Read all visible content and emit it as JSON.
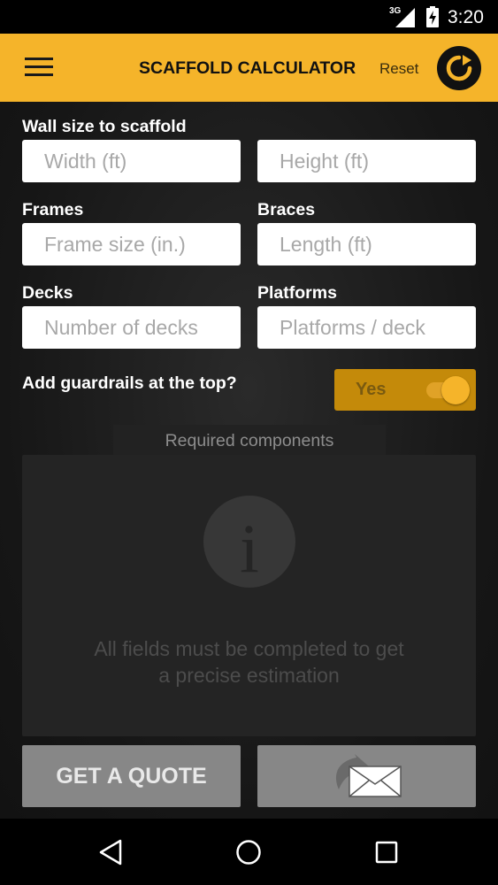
{
  "status_bar": {
    "network": "3G",
    "time": "3:20",
    "icons": [
      "signal-icon",
      "battery-charging-icon"
    ]
  },
  "app_bar": {
    "title": "SCAFFOLD CALCULATOR",
    "reset_label": "Reset",
    "icons": [
      "menu-icon",
      "reset-icon"
    ]
  },
  "colors": {
    "accent": "#f5b42a",
    "background": "#141414",
    "panel": "#242424",
    "button": "#878787"
  },
  "form": {
    "wall_size": {
      "label": "Wall size to scaffold",
      "width_placeholder": "Width (ft)",
      "height_placeholder": "Height (ft)"
    },
    "frames": {
      "label": "Frames",
      "placeholder": "Frame size (in.)"
    },
    "braces": {
      "label": "Braces",
      "placeholder": "Length (ft)"
    },
    "decks": {
      "label": "Decks",
      "placeholder": "Number of decks"
    },
    "platforms": {
      "label": "Platforms",
      "placeholder": "Platforms / deck"
    },
    "guardrails": {
      "label": "Add guardrails at the top?",
      "toggle_label": "Yes",
      "enabled": true
    }
  },
  "results": {
    "tab_label": "Required components",
    "icon": "info-icon",
    "message_line1": "All fields must be completed to get",
    "message_line2": "a precise estimation"
  },
  "actions": {
    "quote_label": "GET A QUOTE",
    "mail_icon": "email-share-icon"
  },
  "nav_bar": {
    "icons": [
      "back-icon",
      "home-icon",
      "recents-icon"
    ]
  }
}
